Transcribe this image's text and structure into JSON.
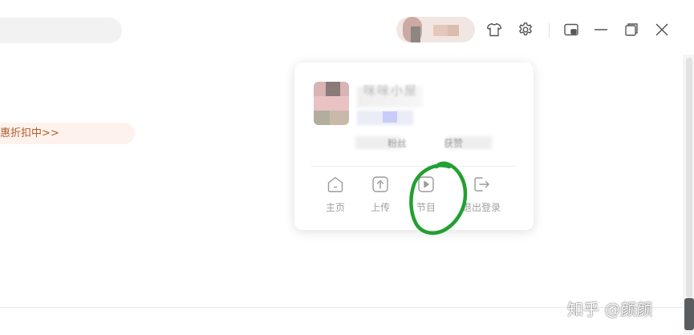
{
  "promo": {
    "text": "惠折扣中>>"
  },
  "header": {
    "icons": [
      "tshirt-icon",
      "gear-icon",
      "mini-window-icon",
      "minimize-icon",
      "maximize-icon",
      "close-icon"
    ]
  },
  "popover": {
    "user_name": "咪咪小屋",
    "stats": [
      {
        "label": "粉丝"
      },
      {
        "label": "获赞"
      }
    ],
    "menu": [
      {
        "id": "home",
        "label": "主页",
        "icon": "home-icon"
      },
      {
        "id": "upload",
        "label": "上传",
        "icon": "upload-icon"
      },
      {
        "id": "programs",
        "label": "节目",
        "icon": "play-icon"
      },
      {
        "id": "logout",
        "label": "退出登录",
        "icon": "logout-icon"
      }
    ]
  },
  "annotation": {
    "color": "#22a032"
  },
  "watermark": {
    "text": "知乎 @颜颜"
  }
}
